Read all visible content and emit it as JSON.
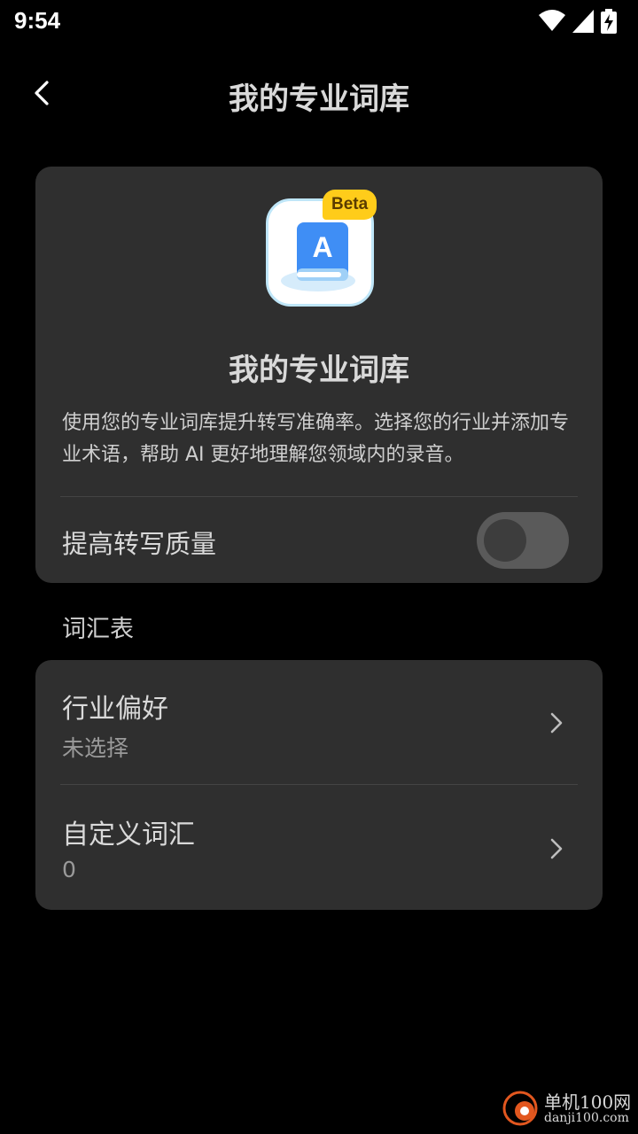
{
  "status_bar": {
    "time": "9:54"
  },
  "header": {
    "title": "我的专业词库"
  },
  "hero": {
    "badge": "Beta",
    "icon_letter": "A",
    "title": "我的专业词库",
    "description": "使用您的专业词库提升转写准确率。选择您的行业并添加专业术语，帮助 AI 更好地理解您领域内的录音。"
  },
  "quality_toggle": {
    "label": "提高转写质量",
    "enabled": false
  },
  "section": {
    "label": "词汇表"
  },
  "list": [
    {
      "title": "行业偏好",
      "subtitle": "未选择"
    },
    {
      "title": "自定义词汇",
      "subtitle": "0"
    }
  ],
  "watermark": {
    "line1": "单机100网",
    "line2": "danji100.com"
  },
  "colors": {
    "background": "#000000",
    "card": "#2f2f2f",
    "badge": "#ffcc1a",
    "icon_blue": "#3f8ef5"
  }
}
